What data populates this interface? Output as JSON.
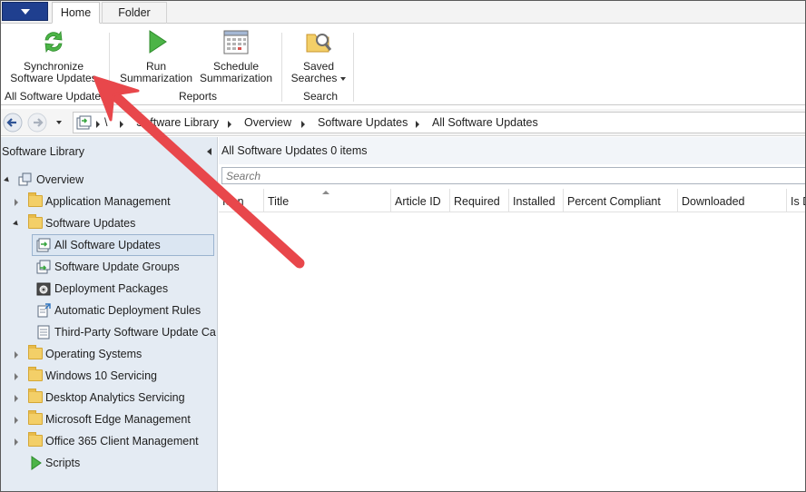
{
  "tabs": {
    "home": "Home",
    "folder": "Folder"
  },
  "ribbon": {
    "sync": {
      "line1": "Synchronize",
      "line2": "Software Updates"
    },
    "run": {
      "line1": "Run",
      "line2": "Summarization"
    },
    "schedule": {
      "line1": "Schedule",
      "line2": "Summarization"
    },
    "saved": {
      "line1": "Saved",
      "line2": "Searches"
    },
    "groups": {
      "all_updates": "All Software Updates",
      "reports": "Reports",
      "search": "Search"
    }
  },
  "breadcrumb": {
    "root": "\\",
    "items": [
      "Software Library",
      "Overview",
      "Software Updates",
      "All Software Updates"
    ]
  },
  "nav": {
    "title": "Software Library",
    "overview": "Overview",
    "application_management": "Application Management",
    "software_updates": "Software Updates",
    "children": [
      "All Software Updates",
      "Software Update Groups",
      "Deployment Packages",
      "Automatic Deployment Rules",
      "Third-Party Software Update Catalogs"
    ],
    "others": [
      "Operating Systems",
      "Windows 10 Servicing",
      "Desktop Analytics Servicing",
      "Microsoft Edge Management",
      "Office 365 Client Management"
    ],
    "scripts": "Scripts"
  },
  "content": {
    "title": "All Software Updates 0 items",
    "search_placeholder": "Search",
    "columns": [
      "Icon",
      "Title",
      "Article ID",
      "Required",
      "Installed",
      "Percent Compliant",
      "Downloaded",
      "Is Deployed"
    ]
  },
  "colors": {
    "accent": "#1f3f8f",
    "nav_bg": "#e4ebf3",
    "arrow": "#e8474b"
  }
}
